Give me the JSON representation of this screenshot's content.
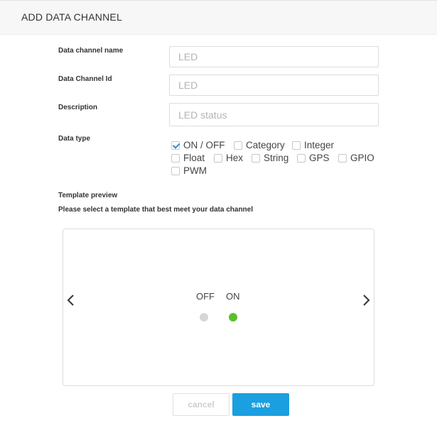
{
  "header": {
    "title": "ADD DATA CHANNEL"
  },
  "form": {
    "name_label": "Data channel name",
    "name_placeholder": "LED",
    "id_label": "Data Channel Id",
    "id_placeholder": "LED",
    "description_label": "Description",
    "description_placeholder": "LED status",
    "datatype_label": "Data type",
    "datatypes": [
      {
        "label": "ON / OFF",
        "checked": true
      },
      {
        "label": "Category",
        "checked": false
      },
      {
        "label": "Integer",
        "checked": false
      },
      {
        "label": "Float",
        "checked": false
      },
      {
        "label": "Hex",
        "checked": false
      },
      {
        "label": "String",
        "checked": false
      },
      {
        "label": "GPS",
        "checked": false
      },
      {
        "label": "GPIO",
        "checked": false
      },
      {
        "label": "PWM",
        "checked": false
      }
    ]
  },
  "template": {
    "title": "Template preview",
    "subtitle": "Please select a template that best meet your data channel",
    "off_label": "OFF",
    "on_label": "ON",
    "off_color": "#d6d6d6",
    "on_color": "#5cbf2a",
    "prev_icon": "chevron-left-icon",
    "next_icon": "chevron-right-icon"
  },
  "actions": {
    "cancel_label": "cancel",
    "save_label": "save",
    "save_color": "#1a9fe0"
  }
}
